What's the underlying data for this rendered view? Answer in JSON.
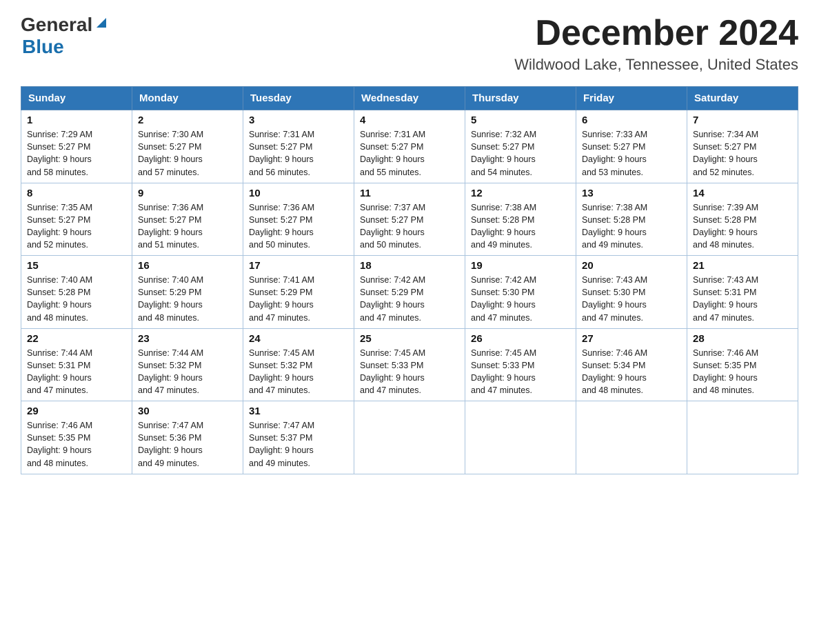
{
  "header": {
    "logo_general": "General",
    "logo_blue": "Blue",
    "main_title": "December 2024",
    "subtitle": "Wildwood Lake, Tennessee, United States"
  },
  "days_of_week": [
    "Sunday",
    "Monday",
    "Tuesday",
    "Wednesday",
    "Thursday",
    "Friday",
    "Saturday"
  ],
  "weeks": [
    [
      {
        "day": "1",
        "sunrise": "7:29 AM",
        "sunset": "5:27 PM",
        "daylight": "9 hours and 58 minutes."
      },
      {
        "day": "2",
        "sunrise": "7:30 AM",
        "sunset": "5:27 PM",
        "daylight": "9 hours and 57 minutes."
      },
      {
        "day": "3",
        "sunrise": "7:31 AM",
        "sunset": "5:27 PM",
        "daylight": "9 hours and 56 minutes."
      },
      {
        "day": "4",
        "sunrise": "7:31 AM",
        "sunset": "5:27 PM",
        "daylight": "9 hours and 55 minutes."
      },
      {
        "day": "5",
        "sunrise": "7:32 AM",
        "sunset": "5:27 PM",
        "daylight": "9 hours and 54 minutes."
      },
      {
        "day": "6",
        "sunrise": "7:33 AM",
        "sunset": "5:27 PM",
        "daylight": "9 hours and 53 minutes."
      },
      {
        "day": "7",
        "sunrise": "7:34 AM",
        "sunset": "5:27 PM",
        "daylight": "9 hours and 52 minutes."
      }
    ],
    [
      {
        "day": "8",
        "sunrise": "7:35 AM",
        "sunset": "5:27 PM",
        "daylight": "9 hours and 52 minutes."
      },
      {
        "day": "9",
        "sunrise": "7:36 AM",
        "sunset": "5:27 PM",
        "daylight": "9 hours and 51 minutes."
      },
      {
        "day": "10",
        "sunrise": "7:36 AM",
        "sunset": "5:27 PM",
        "daylight": "9 hours and 50 minutes."
      },
      {
        "day": "11",
        "sunrise": "7:37 AM",
        "sunset": "5:27 PM",
        "daylight": "9 hours and 50 minutes."
      },
      {
        "day": "12",
        "sunrise": "7:38 AM",
        "sunset": "5:28 PM",
        "daylight": "9 hours and 49 minutes."
      },
      {
        "day": "13",
        "sunrise": "7:38 AM",
        "sunset": "5:28 PM",
        "daylight": "9 hours and 49 minutes."
      },
      {
        "day": "14",
        "sunrise": "7:39 AM",
        "sunset": "5:28 PM",
        "daylight": "9 hours and 48 minutes."
      }
    ],
    [
      {
        "day": "15",
        "sunrise": "7:40 AM",
        "sunset": "5:28 PM",
        "daylight": "9 hours and 48 minutes."
      },
      {
        "day": "16",
        "sunrise": "7:40 AM",
        "sunset": "5:29 PM",
        "daylight": "9 hours and 48 minutes."
      },
      {
        "day": "17",
        "sunrise": "7:41 AM",
        "sunset": "5:29 PM",
        "daylight": "9 hours and 47 minutes."
      },
      {
        "day": "18",
        "sunrise": "7:42 AM",
        "sunset": "5:29 PM",
        "daylight": "9 hours and 47 minutes."
      },
      {
        "day": "19",
        "sunrise": "7:42 AM",
        "sunset": "5:30 PM",
        "daylight": "9 hours and 47 minutes."
      },
      {
        "day": "20",
        "sunrise": "7:43 AM",
        "sunset": "5:30 PM",
        "daylight": "9 hours and 47 minutes."
      },
      {
        "day": "21",
        "sunrise": "7:43 AM",
        "sunset": "5:31 PM",
        "daylight": "9 hours and 47 minutes."
      }
    ],
    [
      {
        "day": "22",
        "sunrise": "7:44 AM",
        "sunset": "5:31 PM",
        "daylight": "9 hours and 47 minutes."
      },
      {
        "day": "23",
        "sunrise": "7:44 AM",
        "sunset": "5:32 PM",
        "daylight": "9 hours and 47 minutes."
      },
      {
        "day": "24",
        "sunrise": "7:45 AM",
        "sunset": "5:32 PM",
        "daylight": "9 hours and 47 minutes."
      },
      {
        "day": "25",
        "sunrise": "7:45 AM",
        "sunset": "5:33 PM",
        "daylight": "9 hours and 47 minutes."
      },
      {
        "day": "26",
        "sunrise": "7:45 AM",
        "sunset": "5:33 PM",
        "daylight": "9 hours and 47 minutes."
      },
      {
        "day": "27",
        "sunrise": "7:46 AM",
        "sunset": "5:34 PM",
        "daylight": "9 hours and 48 minutes."
      },
      {
        "day": "28",
        "sunrise": "7:46 AM",
        "sunset": "5:35 PM",
        "daylight": "9 hours and 48 minutes."
      }
    ],
    [
      {
        "day": "29",
        "sunrise": "7:46 AM",
        "sunset": "5:35 PM",
        "daylight": "9 hours and 48 minutes."
      },
      {
        "day": "30",
        "sunrise": "7:47 AM",
        "sunset": "5:36 PM",
        "daylight": "9 hours and 49 minutes."
      },
      {
        "day": "31",
        "sunrise": "7:47 AM",
        "sunset": "5:37 PM",
        "daylight": "9 hours and 49 minutes."
      },
      null,
      null,
      null,
      null
    ]
  ],
  "labels": {
    "sunrise": "Sunrise:",
    "sunset": "Sunset:",
    "daylight": "Daylight:"
  }
}
